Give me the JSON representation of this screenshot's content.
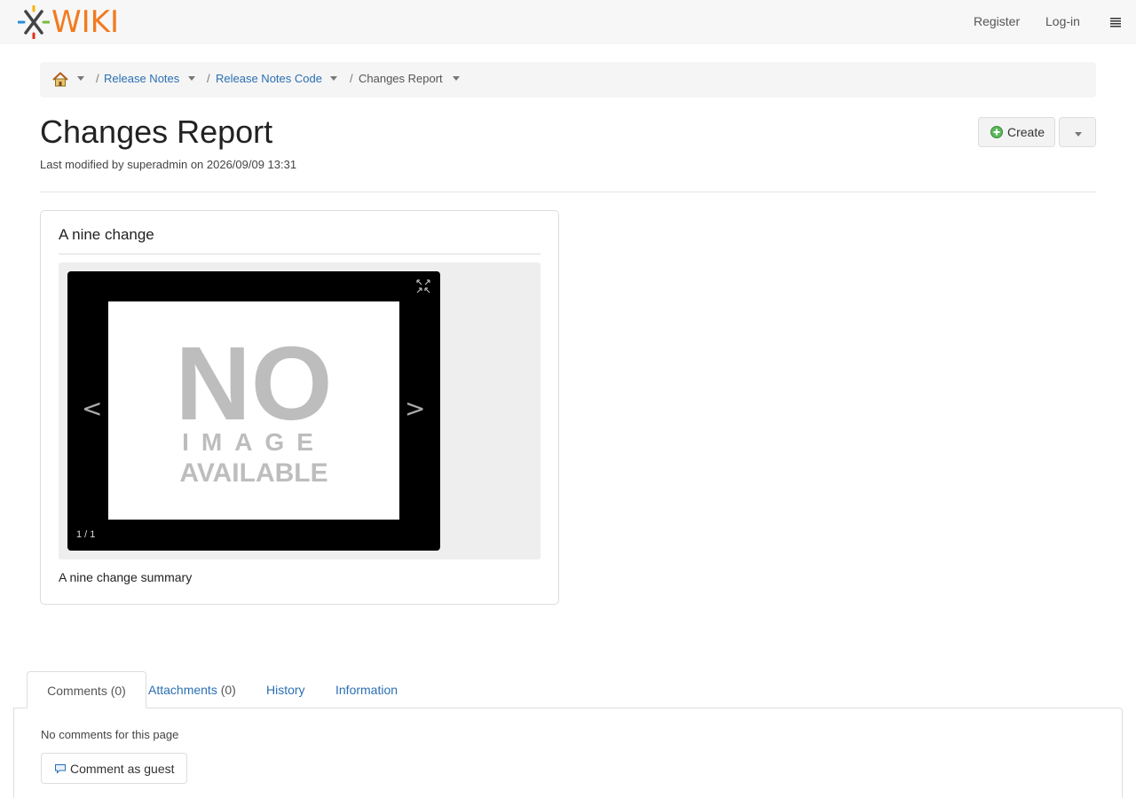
{
  "header": {
    "logo_text": "WIKI",
    "register_label": "Register",
    "login_label": "Log-in"
  },
  "breadcrumb": {
    "items": [
      "Release Notes",
      "Release Notes Code"
    ],
    "current": "Changes Report",
    "separator": "/"
  },
  "page": {
    "title": "Changes Report",
    "meta": "Last modified by superadmin on 2026/09/09 13:31",
    "create_label": "Create"
  },
  "change": {
    "title": "A nine change",
    "summary": "A nine change summary",
    "gallery": {
      "counter": "1 / 1",
      "prev": "<",
      "next": ">",
      "image_text": [
        "NO",
        "IMAGE",
        "AVAILABLE"
      ]
    }
  },
  "tabs": {
    "comments": "Comments",
    "comments_count": "(0)",
    "attachments": "Attachments",
    "attachments_count": "(0)",
    "history": "History",
    "information": "Information"
  },
  "comments": {
    "empty_text": "No comments for this page",
    "button_label": "Comment as guest"
  },
  "colors": {
    "link": "#2a6fb3",
    "logo_orange": "#f27b1f",
    "navbar_bg": "#f7f7f7"
  }
}
